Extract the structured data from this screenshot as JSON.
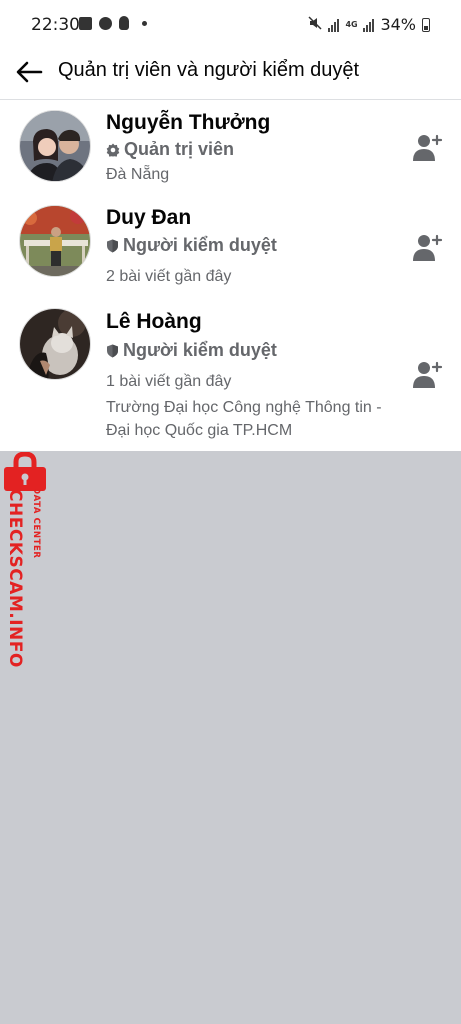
{
  "status_bar": {
    "time": "22:30",
    "battery": "34%",
    "network": "4G"
  },
  "header": {
    "title": "Quản trị viên và người kiểm duyệt"
  },
  "members": [
    {
      "name": "Nguyễn Thưởng",
      "role": "Quản trị viên",
      "lines": [
        "Đà Nẵng"
      ]
    },
    {
      "name": "Duy Đan",
      "role": "Người kiểm duyệt",
      "lines": [
        "2 bài viết gần đây"
      ]
    },
    {
      "name": "Lê Hoàng",
      "role": "Người kiểm duyệt",
      "lines": [
        "1 bài viết gần đây",
        "Trường Đại học Công nghệ Thông tin -",
        "Đại học Quốc gia TP.HCM"
      ]
    }
  ],
  "watermark": {
    "brand": "CHECKSCAM.INFO",
    "tagline": "DATA CENTER"
  },
  "colors": {
    "primary_text": "#050505",
    "secondary_text": "#65676b",
    "background": "#c9cbd0",
    "watermark": "#e32222"
  }
}
